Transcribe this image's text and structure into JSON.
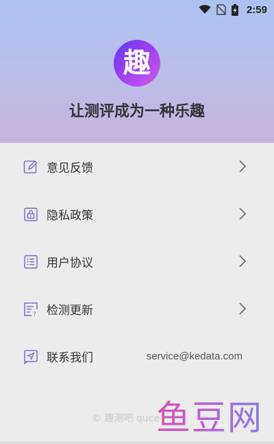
{
  "status_bar": {
    "time": "2:59",
    "icons": [
      "wifi-icon",
      "no-sim-icon",
      "battery-charging-icon"
    ]
  },
  "header": {
    "logo_char": "趣",
    "slogan": "让测评成为一种乐趣"
  },
  "menu": {
    "items": [
      {
        "label": "意见反馈",
        "icon": "edit-icon"
      },
      {
        "label": "隐私政策",
        "icon": "lock-icon"
      },
      {
        "label": "用户协议",
        "icon": "list-icon"
      },
      {
        "label": "检测更新",
        "icon": "update-check-icon"
      },
      {
        "label": "联系我们",
        "icon": "send-icon",
        "value": "service@kedata.com"
      }
    ]
  },
  "footer": {
    "copyright": "© 趣测吧 quce"
  },
  "watermark": {
    "text": "鱼豆网"
  },
  "colors": {
    "icon_accent": "#7b6fc6",
    "header_top": "#aec2f2",
    "header_bottom": "#c7b4de",
    "logo_start": "#5a3df0",
    "logo_end": "#d15de8"
  }
}
